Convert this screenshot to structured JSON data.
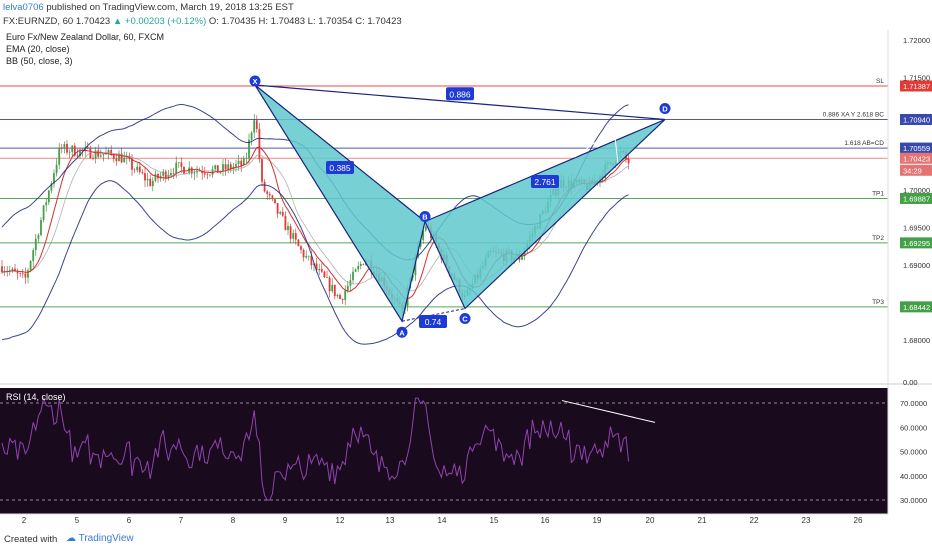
{
  "header": {
    "author": "lelva0706",
    "published": "published on TradingView.com, March 19, 2018 13:25 EST",
    "symbol": "FX:EURNZD, 60",
    "price": "1.70423",
    "change": "+0.00203 (+0.12%)",
    "open": "O: 1.70435",
    "high": "H: 1.70483",
    "low": "L: 1.70354",
    "close": "C: 1.70423"
  },
  "legend": {
    "title": "Euro Fx/New Zealand Dollar, 60, FXCM",
    "ema": "EMA (20, close)",
    "bb": "BB (50, close, 3)",
    "rsi": "RSI (14, close)"
  },
  "colors": {
    "background": "#ffffff",
    "rsi_background": "#1a0a1e",
    "pattern_fill": "#5fc9cc",
    "pattern_stroke": "#1a237e",
    "bb": "#1a237e",
    "ema": "#d32f2f",
    "sma": "#e0e0e0",
    "stop_line": "#e53935",
    "target_line": "#43a047",
    "level_line": "#3949ab",
    "rsi_line": "#8e44ad"
  },
  "price_axis": {
    "ticks": [
      "1.72000",
      "1.71500",
      "1.70000",
      "1.69500",
      "1.69000",
      "1.68000",
      "0.00"
    ],
    "labels": [
      {
        "text": "1.71387",
        "type": "stop"
      },
      {
        "text": "1.70940",
        "type": "level"
      },
      {
        "text": "1.70559",
        "type": "level"
      },
      {
        "text": "1.70423",
        "type": "current"
      },
      {
        "text": "34:29",
        "type": "timer"
      },
      {
        "text": "1.69887",
        "type": "target"
      },
      {
        "text": "1.69295",
        "type": "target"
      },
      {
        "text": "1.68442",
        "type": "target"
      }
    ]
  },
  "level_lines": [
    {
      "name": "SL",
      "price": 1.71387,
      "type": "stop"
    },
    {
      "name": "0.886 XA Y 2.618 BC",
      "price": 1.7094,
      "type": "level"
    },
    {
      "name": "1.618 AB=CD",
      "price": 1.70559,
      "type": "level"
    },
    {
      "name": "",
      "price": 1.70423,
      "type": "current"
    },
    {
      "name": "TP1",
      "price": 1.69887,
      "type": "target"
    },
    {
      "name": "TP2",
      "price": 1.69295,
      "type": "target"
    },
    {
      "name": "TP3",
      "price": 1.68442,
      "type": "target"
    }
  ],
  "pattern": {
    "points": [
      {
        "label": "X",
        "price": 1.714
      },
      {
        "label": "A",
        "price": 1.6825
      },
      {
        "label": "B",
        "price": 1.6958
      },
      {
        "label": "C",
        "price": 1.6842
      },
      {
        "label": "D",
        "price": 1.7094
      }
    ],
    "ratios": [
      "0.886",
      "0.385",
      "0.74",
      "2.761"
    ]
  },
  "rsi_axis": {
    "ticks": [
      "70.0000",
      "60.0000",
      "50.0000",
      "40.0000",
      "30.0000"
    ]
  },
  "time_axis": {
    "ticks": [
      "2",
      "5",
      "6",
      "7",
      "8",
      "9",
      "12",
      "13",
      "14",
      "15",
      "16",
      "19",
      "20",
      "21",
      "22",
      "23",
      "26"
    ]
  },
  "footer": {
    "created": "Created with",
    "brand": "TradingView"
  }
}
